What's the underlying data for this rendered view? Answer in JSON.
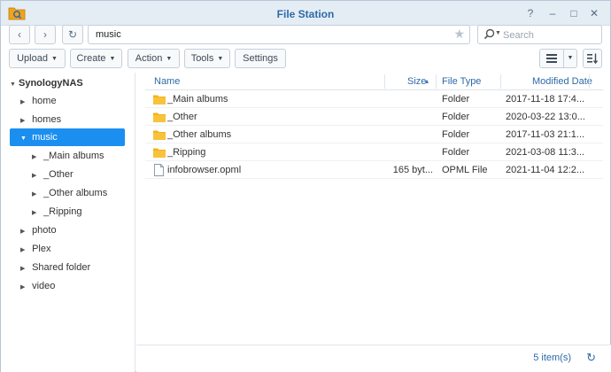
{
  "window": {
    "title": "File Station",
    "controls": {
      "help": "?",
      "minimize": "–",
      "maximize": "□",
      "close": "✕"
    }
  },
  "navbar": {
    "back_icon": "chevron-left-icon",
    "forward_icon": "chevron-right-icon",
    "refresh_icon": "refresh-icon",
    "path_value": "music",
    "favorite_icon": "star-icon",
    "search_placeholder": "Search"
  },
  "toolbar": {
    "upload": "Upload",
    "create": "Create",
    "action": "Action",
    "tools": "Tools",
    "settings": "Settings"
  },
  "sidebar": {
    "root": "SynologyNAS",
    "items": [
      {
        "label": "home"
      },
      {
        "label": "homes"
      },
      {
        "label": "music"
      },
      {
        "label": "_Main albums"
      },
      {
        "label": "_Other"
      },
      {
        "label": "_Other albums"
      },
      {
        "label": "_Ripping"
      },
      {
        "label": "photo"
      },
      {
        "label": "Plex"
      },
      {
        "label": "Shared folder"
      },
      {
        "label": "video"
      }
    ]
  },
  "grid": {
    "columns": {
      "name": "Name",
      "size": "Size",
      "type": "File Type",
      "modified": "Modified Date"
    },
    "sort_indicator": "▴",
    "rows": [
      {
        "name": "_Main albums",
        "size": "",
        "type": "Folder",
        "modified": "2017-11-18 17:4...",
        "kind": "folder"
      },
      {
        "name": "_Other",
        "size": "",
        "type": "Folder",
        "modified": "2020-03-22 13:0...",
        "kind": "folder"
      },
      {
        "name": "_Other albums",
        "size": "",
        "type": "Folder",
        "modified": "2017-11-03 21:1...",
        "kind": "folder"
      },
      {
        "name": "_Ripping",
        "size": "",
        "type": "Folder",
        "modified": "2021-03-08 11:3...",
        "kind": "folder"
      },
      {
        "name": "infobrowser.opml",
        "size": "165 byt...",
        "type": "OPML File",
        "modified": "2021-11-04 12:2...",
        "kind": "file"
      }
    ]
  },
  "footer": {
    "item_count": "5 item(s)"
  },
  "colors": {
    "accent": "#1b8ff0",
    "title": "#2d6aa8",
    "folder": "#f5b21a"
  }
}
